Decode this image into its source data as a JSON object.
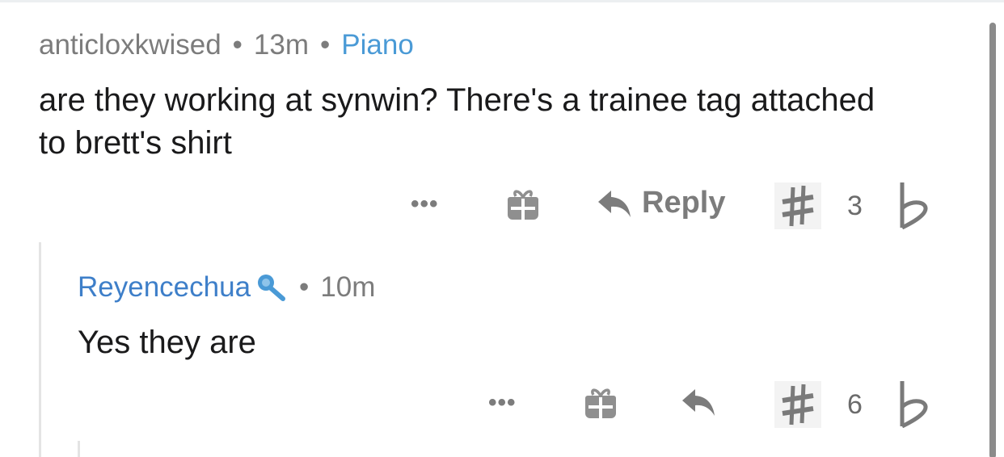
{
  "comments": [
    {
      "username": "anticloxkwised",
      "time": "13m",
      "flair": "Piano",
      "body": "are they working at synwin? There's a trainee tag attached to brett's shirt",
      "actions": {
        "more": "•••",
        "reply_label": "Reply",
        "score": "3"
      }
    },
    {
      "username": "Reyencechua",
      "time": "10m",
      "body": "Yes they are",
      "actions": {
        "more": "•••",
        "score": "6"
      }
    }
  ],
  "separator": "•",
  "colors": {
    "meta_gray": "#7c7c7c",
    "flair_blue": "#4a9ad6",
    "username_blue": "#3e7fc9",
    "text": "#1a1a1b"
  },
  "icons": {
    "more": "ellipsis-icon",
    "award": "gift-icon",
    "reply": "reply-arrow-icon",
    "upvote": "sharp-icon",
    "downvote": "flat-icon",
    "badge": "microphone-icon"
  }
}
